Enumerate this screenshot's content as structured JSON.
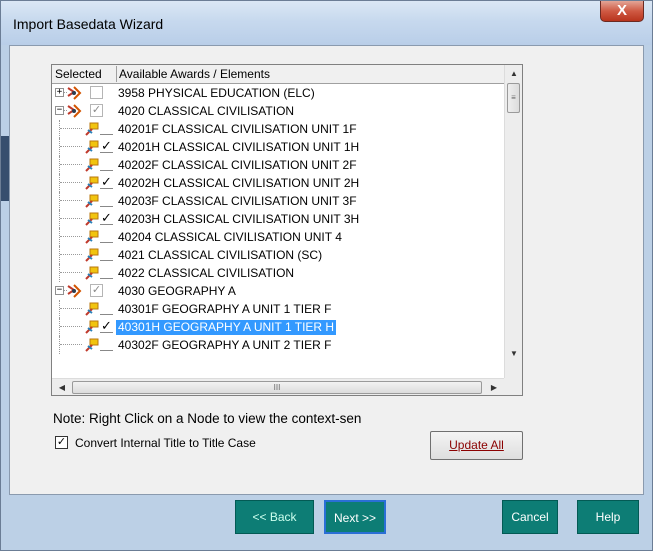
{
  "window": {
    "title": "Import Basedata Wizard",
    "close_glyph": "X"
  },
  "tree": {
    "col_selected": "Selected",
    "col_available": "Available Awards / Elements",
    "rows": [
      {
        "label": "3958 PHYSICAL EDUCATION (ELC)",
        "check": ""
      },
      {
        "label": "4020 CLASSICAL CIVILISATION",
        "check": "✓"
      },
      {
        "label": "40201F CLASSICAL CIVILISATION UNIT 1F",
        "check": ""
      },
      {
        "label": "40201H CLASSICAL CIVILISATION UNIT 1H",
        "check": "✓"
      },
      {
        "label": "40202F CLASSICAL CIVILISATION UNIT 2F",
        "check": ""
      },
      {
        "label": "40202H CLASSICAL CIVILISATION UNIT 2H",
        "check": "✓"
      },
      {
        "label": "40203F CLASSICAL CIVILISATION UNIT 3F",
        "check": ""
      },
      {
        "label": "40203H CLASSICAL CIVILISATION UNIT 3H",
        "check": "✓"
      },
      {
        "label": "40204 CLASSICAL CIVILISATION UNIT 4",
        "check": ""
      },
      {
        "label": "4021 CLASSICAL CIVILISATION (SC)",
        "check": ""
      },
      {
        "label": "4022 CLASSICAL CIVILISATION",
        "check": ""
      },
      {
        "label": "4030 GEOGRAPHY A",
        "check": "✓"
      },
      {
        "label": "40301F GEOGRAPHY A UNIT 1 TIER F",
        "check": ""
      },
      {
        "label": "40301H GEOGRAPHY A UNIT 1 TIER H",
        "check": "✓"
      },
      {
        "label": "40302F GEOGRAPHY A UNIT 2 TIER F",
        "check": ""
      }
    ],
    "expander_plus": "+",
    "expander_minus": "−"
  },
  "note": "Note: Right Click on a Node to view the context-sen",
  "convert": {
    "label": "Convert Internal Title to Title Case",
    "checked_glyph": "✓"
  },
  "buttons": {
    "update_all": "Update All",
    "back": "<< Back",
    "next": "Next >>",
    "cancel": "Cancel",
    "help": "Help"
  },
  "scroll": {
    "up": "▲",
    "down": "▼",
    "left": "◀",
    "right": "▶",
    "grip_v": "≡",
    "grip_h": "III"
  },
  "colors": {
    "selection": "#3399ff",
    "wizard_button": "#0d7d75",
    "window_frame": "#bcd0e6"
  }
}
